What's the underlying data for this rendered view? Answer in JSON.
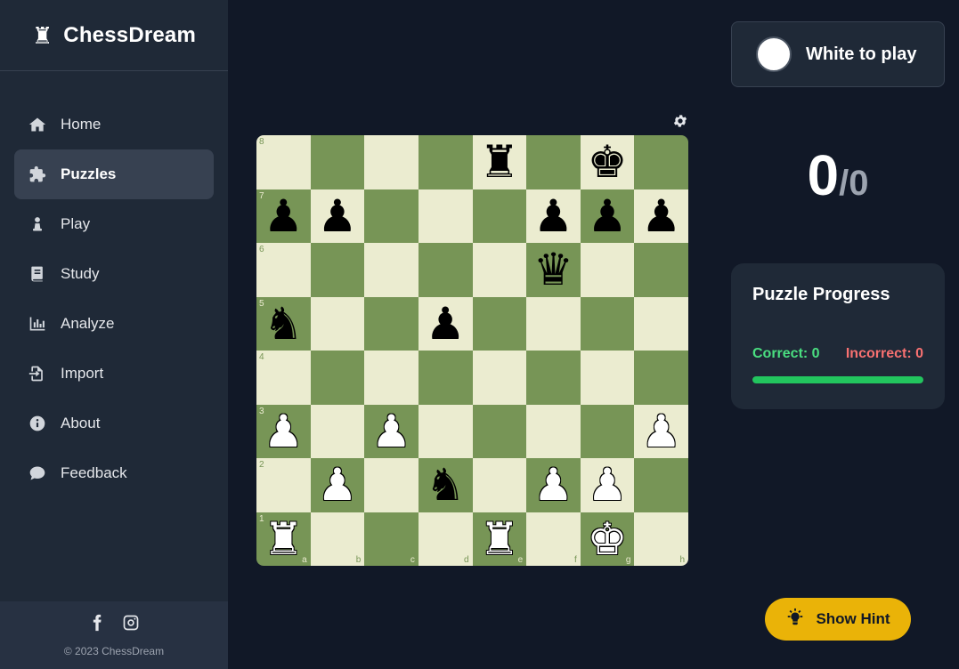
{
  "brand": {
    "name": "ChessDream",
    "icon": "rook-icon"
  },
  "nav": [
    {
      "id": "home",
      "label": "Home",
      "icon": "home-icon",
      "active": false
    },
    {
      "id": "puzzles",
      "label": "Puzzles",
      "icon": "puzzle-icon",
      "active": true
    },
    {
      "id": "play",
      "label": "Play",
      "icon": "pawn-icon",
      "active": false
    },
    {
      "id": "study",
      "label": "Study",
      "icon": "book-icon",
      "active": false
    },
    {
      "id": "analyze",
      "label": "Analyze",
      "icon": "chart-icon",
      "active": false
    },
    {
      "id": "import",
      "label": "Import",
      "icon": "import-icon",
      "active": false
    },
    {
      "id": "about",
      "label": "About",
      "icon": "info-icon",
      "active": false
    },
    {
      "id": "feedback",
      "label": "Feedback",
      "icon": "comment-icon",
      "active": false
    }
  ],
  "footer": {
    "copyright": "© 2023 ChessDream",
    "social": [
      "facebook-icon",
      "instagram-icon"
    ]
  },
  "board": {
    "files": [
      "a",
      "b",
      "c",
      "d",
      "e",
      "f",
      "g",
      "h"
    ],
    "ranks": [
      "8",
      "7",
      "6",
      "5",
      "4",
      "3",
      "2",
      "1"
    ],
    "position": [
      [
        "",
        "",
        "",
        "",
        "r",
        "",
        "k",
        ""
      ],
      [
        "p",
        "p",
        "",
        "",
        "",
        "p",
        "p",
        "p"
      ],
      [
        "",
        "",
        "",
        "",
        "",
        "q",
        "",
        ""
      ],
      [
        "n",
        "",
        "",
        "p",
        "",
        "",
        "",
        ""
      ],
      [
        "",
        "",
        "",
        "",
        "",
        "",
        "",
        ""
      ],
      [
        "P",
        "",
        "P",
        "",
        "",
        "",
        "",
        "P"
      ],
      [
        "",
        "P",
        "",
        "n",
        "",
        "P",
        "P",
        ""
      ],
      [
        "R",
        "",
        "",
        "",
        "R",
        "",
        "K",
        ""
      ]
    ],
    "colors": {
      "light": "#ebecd0",
      "dark": "#779556"
    }
  },
  "turn": {
    "label": "White to play",
    "color": "white"
  },
  "score": {
    "solved": "0",
    "total": "/0"
  },
  "progress": {
    "title": "Puzzle Progress",
    "correct_label": "Correct: 0",
    "incorrect_label": "Incorrect: 0",
    "correct_fraction": 1.0
  },
  "hint": {
    "label": "Show Hint",
    "icon": "lightbulb-icon"
  },
  "colors": {
    "accent": "#eab308",
    "success": "#22c55e",
    "danger": "#f87171",
    "background": "#111827",
    "panel": "#1f2937"
  }
}
